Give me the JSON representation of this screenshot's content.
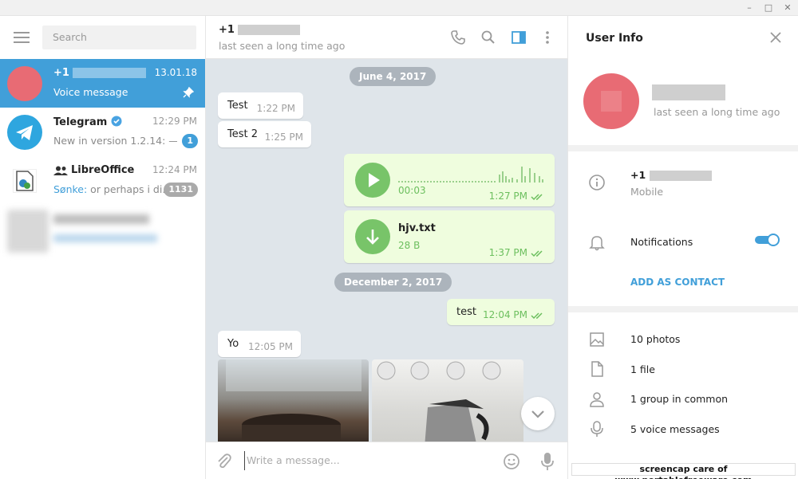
{
  "window": {
    "minimize": "–",
    "maximize": "□",
    "close": "✕"
  },
  "sidebar": {
    "search_placeholder": "Search",
    "chats": [
      {
        "name": "+1",
        "time": "13.01.18",
        "preview": "Voice message",
        "avatar_color": "#e86b74"
      },
      {
        "name": "Telegram",
        "time": "12:29 PM",
        "preview": "New in version 1.2.14: —...",
        "badge": "1",
        "avatar_color": "#2ea6df"
      },
      {
        "name": "LibreOffice",
        "time": "12:24 PM",
        "preview_sender": "Sønke:",
        "preview": " or perhaps i di...",
        "badge": "1131"
      }
    ]
  },
  "chat": {
    "title": "+1",
    "status": "last seen a long time ago",
    "composer_placeholder": "Write a message...",
    "dates": [
      "June 4, 2017",
      "December 2, 2017"
    ],
    "messages": [
      {
        "text": "Test",
        "time": "1:22 PM"
      },
      {
        "text": "Test 2",
        "time": "1:25 PM"
      },
      {
        "voice_duration": "00:03",
        "time": "1:27 PM"
      },
      {
        "file_name": "hjv.txt",
        "file_size": "28 B",
        "time": "1:37 PM"
      },
      {
        "text": "test",
        "time": "12:04 PM"
      },
      {
        "text": "Yo",
        "time": "12:05 PM"
      }
    ]
  },
  "info": {
    "header": "User Info",
    "status": "last seen a long time ago",
    "phone_prefix": "+1",
    "phone_label": "Mobile",
    "notifications": "Notifications",
    "add_contact": "ADD AS CONTACT",
    "media": [
      "10 photos",
      "1 file",
      "1 group in common",
      "5 voice messages"
    ],
    "accent": "#419fd9"
  },
  "watermark": "screencap care of www.portablefreeware.com"
}
